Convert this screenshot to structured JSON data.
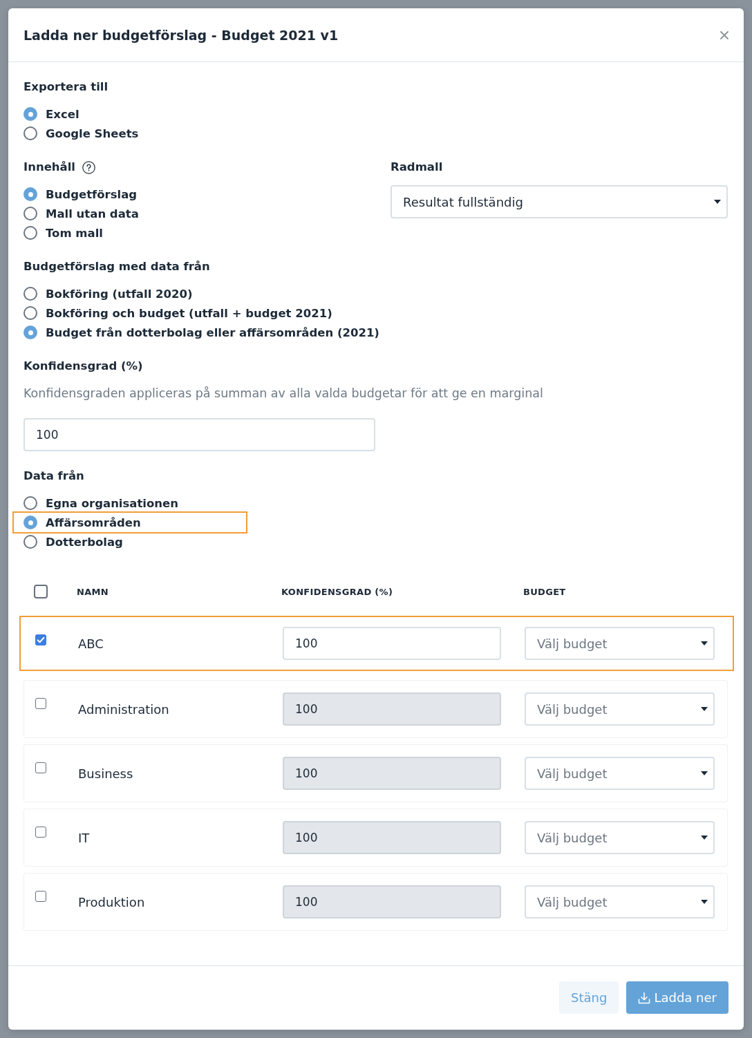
{
  "dialog": {
    "title": "Ladda ner budgetförslag - Budget 2021 v1"
  },
  "export": {
    "label": "Exportera till",
    "options": [
      {
        "label": "Excel",
        "selected": true
      },
      {
        "label": "Google Sheets",
        "selected": false
      }
    ]
  },
  "content": {
    "label": "Innehåll",
    "options": [
      {
        "label": "Budgetförslag",
        "selected": true
      },
      {
        "label": "Mall utan data",
        "selected": false
      },
      {
        "label": "Tom mall",
        "selected": false
      }
    ]
  },
  "row_template": {
    "label": "Radmall",
    "value": "Resultat fullständig"
  },
  "data_source": {
    "label": "Budgetförslag med data från",
    "options": [
      {
        "label": "Bokföring (utfall 2020)",
        "selected": false
      },
      {
        "label": "Bokföring och budget (utfall + budget 2021)",
        "selected": false
      },
      {
        "label": "Budget från dotterbolag eller affärsområden (2021)",
        "selected": true
      }
    ]
  },
  "confidence": {
    "label": "Konfidensgrad (%)",
    "description": "Konfidensgraden appliceras på summan av alla valda budgetar för att ge en marginal",
    "value": "100"
  },
  "data_from": {
    "label": "Data från",
    "options": [
      {
        "label": "Egna organisationen",
        "selected": false,
        "highlighted": false
      },
      {
        "label": "Affärsområden",
        "selected": true,
        "highlighted": true
      },
      {
        "label": "Dotterbolag",
        "selected": false,
        "highlighted": false
      }
    ]
  },
  "table": {
    "select_all_checked": false,
    "columns": [
      "NAMN",
      "KONFIDENSGRAD (%)",
      "BUDGET"
    ],
    "rows": [
      {
        "name": "ABC",
        "checked": true,
        "highlighted": true,
        "confidence": {
          "value": "100",
          "disabled": false
        },
        "budget": {
          "placeholder": "Välj budget"
        }
      },
      {
        "name": "Administration",
        "checked": false,
        "highlighted": false,
        "confidence": {
          "value": "100",
          "disabled": true
        },
        "budget": {
          "placeholder": "Välj budget"
        }
      },
      {
        "name": "Business",
        "checked": false,
        "highlighted": false,
        "confidence": {
          "value": "100",
          "disabled": true
        },
        "budget": {
          "placeholder": "Välj budget"
        }
      },
      {
        "name": "IT",
        "checked": false,
        "highlighted": false,
        "confidence": {
          "value": "100",
          "disabled": true
        },
        "budget": {
          "placeholder": "Välj budget"
        }
      },
      {
        "name": "Produktion",
        "checked": false,
        "highlighted": false,
        "confidence": {
          "value": "100",
          "disabled": true
        },
        "budget": {
          "placeholder": "Välj budget"
        }
      }
    ]
  },
  "buttons": [
    {
      "label": "Stäng",
      "kind": "secondary"
    },
    {
      "label": "Ladda ner",
      "kind": "primary"
    }
  ]
}
